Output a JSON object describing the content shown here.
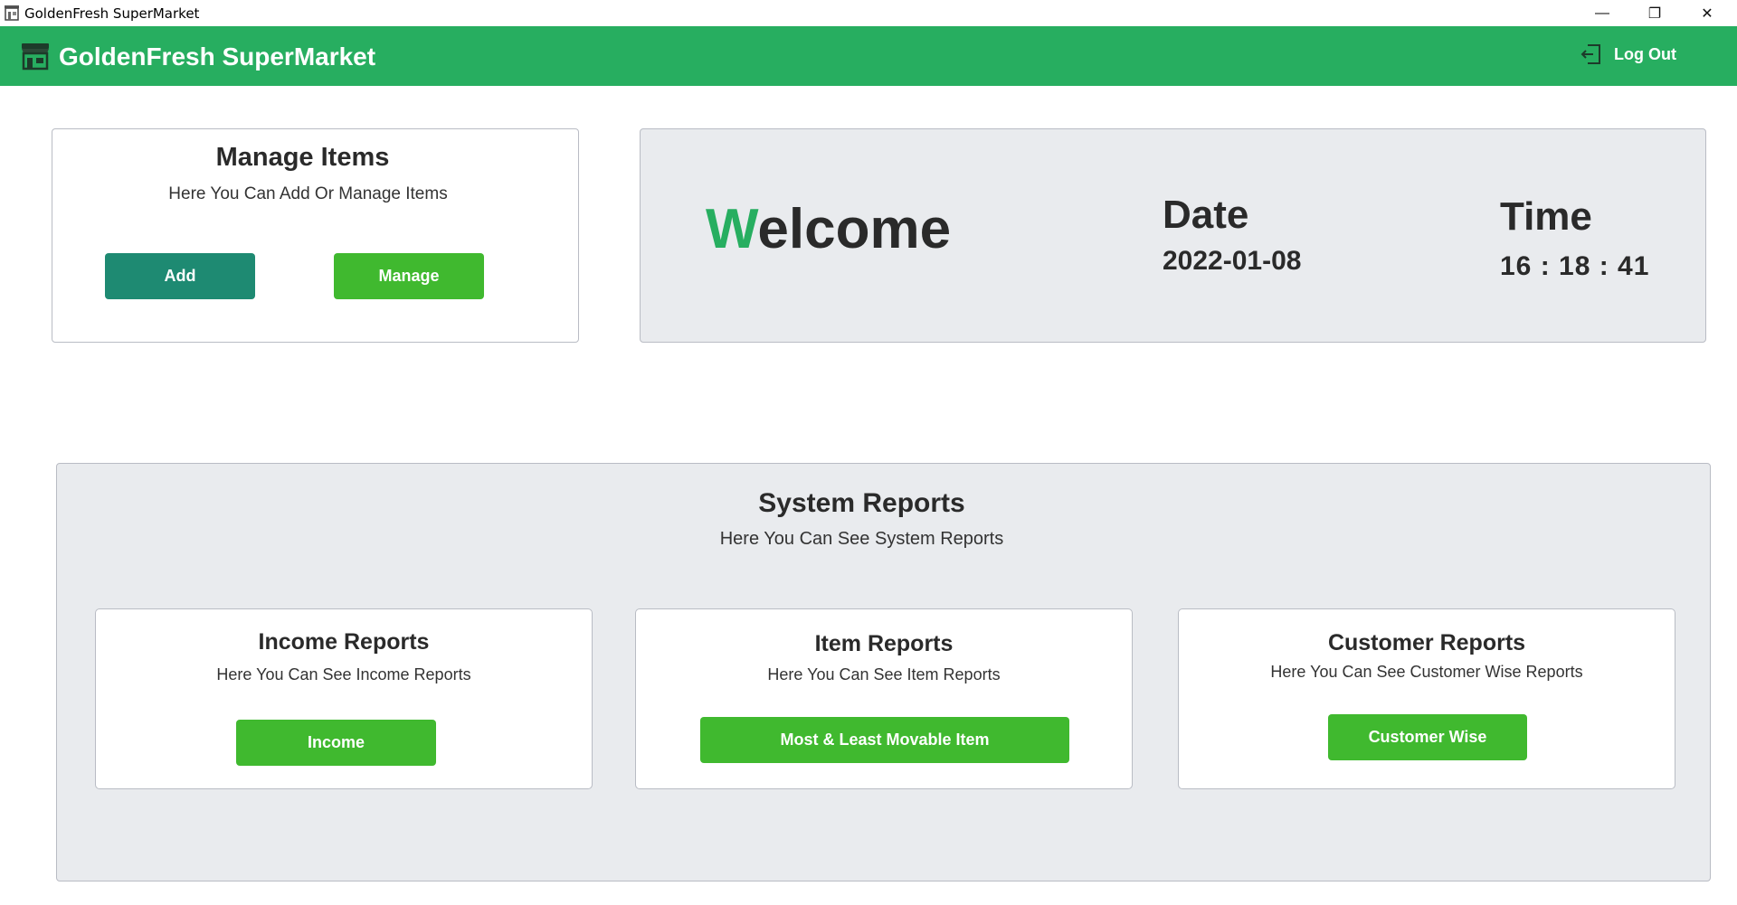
{
  "window": {
    "title": "GoldenFresh SuperMarket",
    "minimize_glyph": "—",
    "maximize_glyph": "❐",
    "close_glyph": "✕"
  },
  "header": {
    "brand": "GoldenFresh SuperMarket",
    "logout_label": "Log Out",
    "logo_icon": "store-icon",
    "logout_icon": "logout-icon"
  },
  "manage_items": {
    "title": "Manage Items",
    "subtitle": "Here You Can Add Or Manage Items",
    "add_label": "Add",
    "manage_label": "Manage"
  },
  "welcome": {
    "first_letter": "W",
    "rest": "elcome",
    "date_label": "Date",
    "date_value": "2022-01-08",
    "time_label": "Time",
    "time_value": "16 : 18 : 41"
  },
  "system_reports": {
    "title": "System Reports",
    "subtitle": "Here You Can See System Reports",
    "cards": [
      {
        "title": "Income Reports",
        "subtitle": "Here You Can See Income Reports",
        "button": "Income"
      },
      {
        "title": "Item Reports",
        "subtitle": "Here You Can See Item Reports",
        "button": "Most & Least Movable Item"
      },
      {
        "title": "Customer Reports",
        "subtitle": "Here You Can See Customer Wise Reports",
        "button": "Customer Wise"
      }
    ]
  },
  "colors": {
    "header_green": "#27ae60",
    "button_green": "#40b92f",
    "button_teal": "#1e8a72",
    "panel_gray": "#e9ebee"
  }
}
